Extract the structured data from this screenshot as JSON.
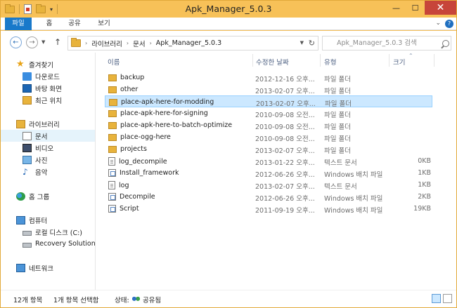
{
  "window": {
    "title": "Apk_Manager_5.0.3"
  },
  "ribbon": {
    "tabs": [
      "파일",
      "홈",
      "공유",
      "보기"
    ]
  },
  "nav": {
    "breadcrumb": [
      "라이브러리",
      "문서",
      "Apk_Manager_5.0.3"
    ],
    "search_placeholder": "Apk_Manager_5.0.3 검색"
  },
  "sidebar": {
    "favorites": {
      "label": "즐겨찾기",
      "items": [
        "다운로드",
        "바탕 화면",
        "최근 위치"
      ]
    },
    "libraries": {
      "label": "라이브러리",
      "items": [
        "문서",
        "비디오",
        "사진",
        "음악"
      ]
    },
    "homegroup": {
      "label": "홈 그룹"
    },
    "computer": {
      "label": "컴퓨터",
      "items": [
        "로컬 디스크 (C:)",
        "Recovery Solution ("
      ]
    },
    "network": {
      "label": "네트워크"
    }
  },
  "columns": {
    "name": "이름",
    "date": "수정한 날짜",
    "type": "유형",
    "size": "크기"
  },
  "files": [
    {
      "name": "backup",
      "date": "2012-12-16 오후...",
      "type": "파일 폴더",
      "size": "",
      "kind": "folder"
    },
    {
      "name": "other",
      "date": "2013-02-07 오후...",
      "type": "파일 폴더",
      "size": "",
      "kind": "folder"
    },
    {
      "name": "place-apk-here-for-modding",
      "date": "2013-02-07 오후...",
      "type": "파일 폴더",
      "size": "",
      "kind": "folder",
      "selected": true
    },
    {
      "name": "place-apk-here-for-signing",
      "date": "2010-09-08 오전...",
      "type": "파일 폴더",
      "size": "",
      "kind": "folder"
    },
    {
      "name": "place-apk-here-to-batch-optimize",
      "date": "2010-09-08 오전...",
      "type": "파일 폴더",
      "size": "",
      "kind": "folder"
    },
    {
      "name": "place-ogg-here",
      "date": "2010-09-08 오전...",
      "type": "파일 폴더",
      "size": "",
      "kind": "folder"
    },
    {
      "name": "projects",
      "date": "2013-02-07 오후...",
      "type": "파일 폴더",
      "size": "",
      "kind": "folder"
    },
    {
      "name": "log_decompile",
      "date": "2013-01-22 오후...",
      "type": "텍스트 문서",
      "size": "0KB",
      "kind": "text"
    },
    {
      "name": "Install_framework",
      "date": "2012-06-26 오후...",
      "type": "Windows 배치 파일",
      "size": "1KB",
      "kind": "batch"
    },
    {
      "name": "log",
      "date": "2013-02-07 오후...",
      "type": "텍스트 문서",
      "size": "1KB",
      "kind": "text"
    },
    {
      "name": "Decompile",
      "date": "2012-06-26 오후...",
      "type": "Windows 배치 파일",
      "size": "2KB",
      "kind": "batch"
    },
    {
      "name": "Script",
      "date": "2011-09-19 오후...",
      "type": "Windows 배치 파일",
      "size": "19KB",
      "kind": "batch"
    }
  ],
  "status": {
    "count": "12개 항목",
    "selected": "1개 항목 선택함",
    "state_label": "상태:",
    "state_value": "공유됨"
  },
  "colors": {
    "title_bg": "#f7c158",
    "file_tab": "#1979ca",
    "selection": "#cce8ff",
    "close": "#c7453a"
  }
}
